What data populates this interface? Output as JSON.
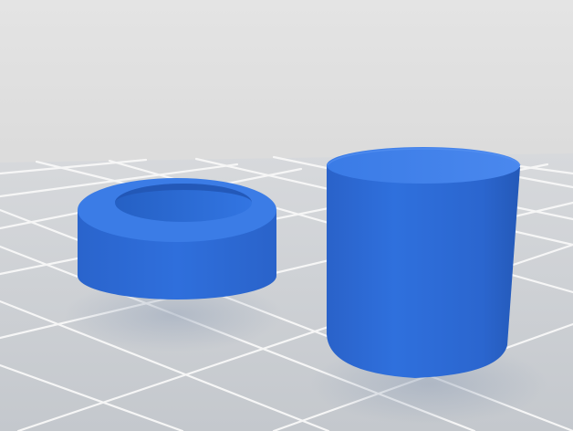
{
  "scene": {
    "background_color": "#e6e6e6",
    "floor_color": "#cfd2d6",
    "grid_color": "#f7f7f7",
    "object_color": "#2e6fdc",
    "object_shadow_color": "#2458b8",
    "object_highlight_color": "#4f8bf0",
    "objects": [
      {
        "name": "ring-spacer",
        "shape": "hollow cylinder"
      },
      {
        "name": "solid-cylinder",
        "shape": "cylinder"
      }
    ]
  }
}
